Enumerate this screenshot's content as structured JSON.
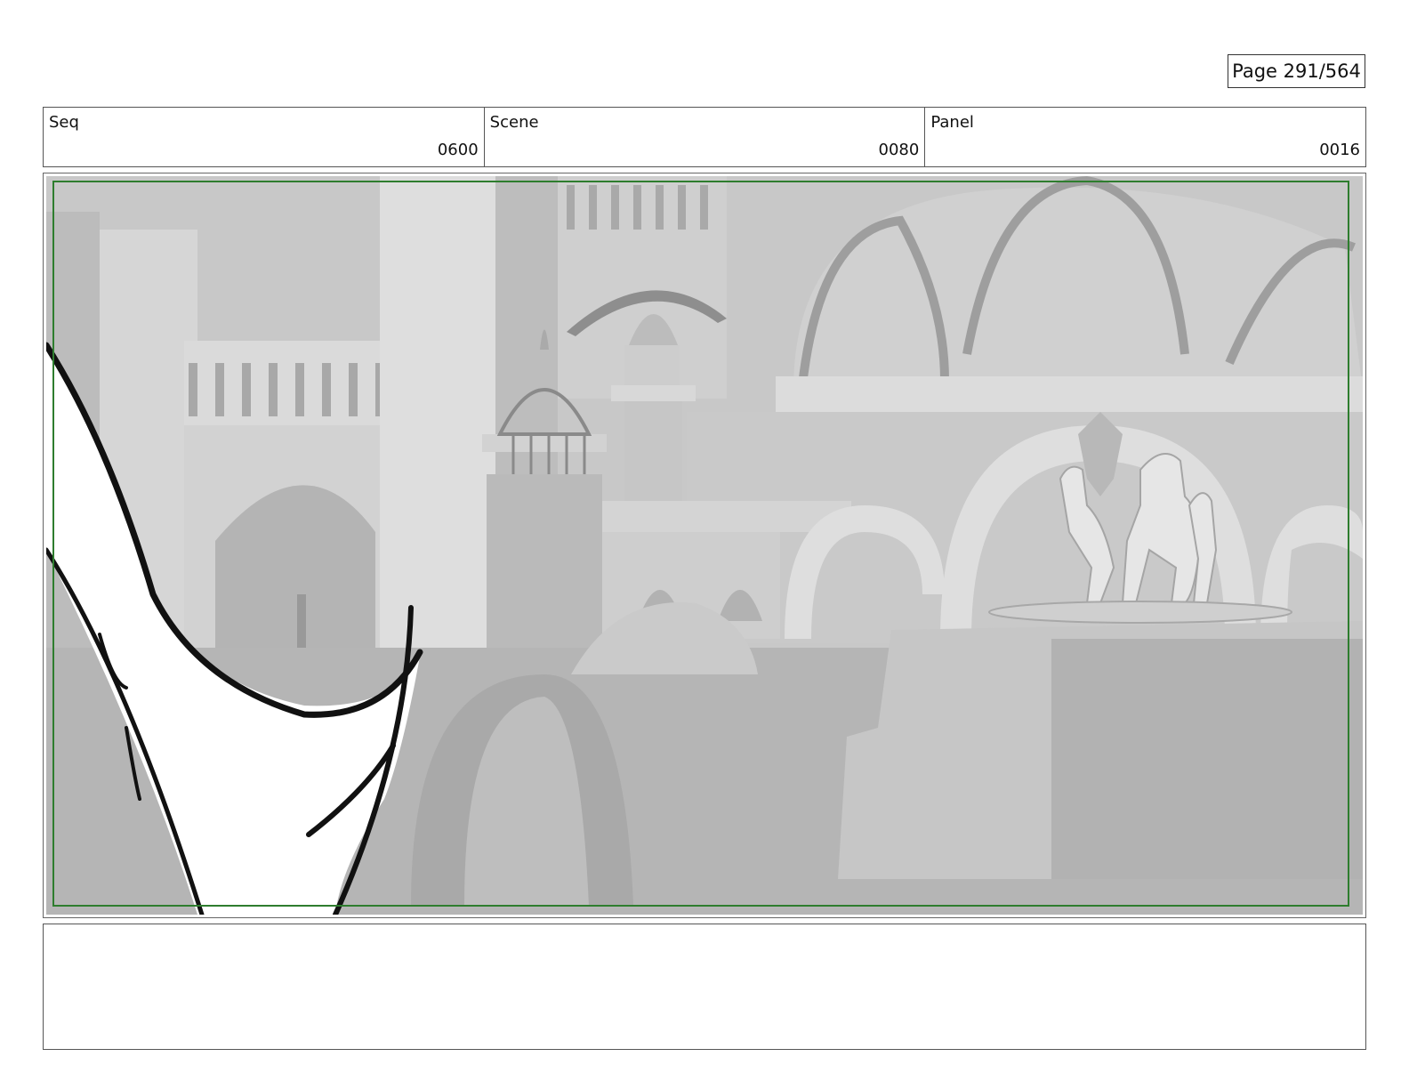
{
  "page": {
    "number_label": "Page 291/564"
  },
  "header": {
    "seq": {
      "label": "Seq",
      "value": "0600"
    },
    "scene": {
      "label": "Scene",
      "value": "0080"
    },
    "panel": {
      "label": "Panel",
      "value": "0016"
    }
  },
  "artwork": {
    "icon": "storyboard-panel-image",
    "safe_frame_color": "#2e7d2e",
    "background_color": "#c4c4c4",
    "ink_color": "#111111"
  },
  "notes": {
    "text": ""
  }
}
